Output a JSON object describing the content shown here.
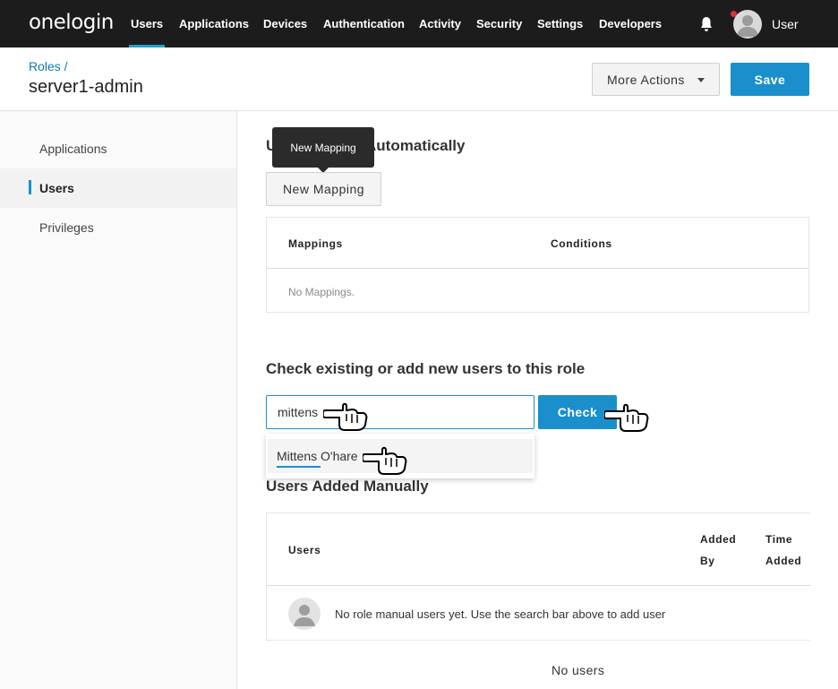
{
  "topnav": {
    "logo": "onelogin",
    "items": [
      {
        "label": "Users",
        "active": true
      },
      {
        "label": "Applications",
        "active": false
      },
      {
        "label": "Devices",
        "active": false
      },
      {
        "label": "Authentication",
        "active": false
      },
      {
        "label": "Activity",
        "active": false
      },
      {
        "label": "Security",
        "active": false
      },
      {
        "label": "Settings",
        "active": false
      },
      {
        "label": "Developers",
        "active": false
      }
    ],
    "user_label": "User",
    "bell_icon": "bell-icon",
    "notification_color": "#e0303a"
  },
  "header": {
    "breadcrumb": "Roles /",
    "title": "server1-admin",
    "more_actions_label": "More Actions",
    "save_label": "Save"
  },
  "sidebar": {
    "items": [
      {
        "label": "Applications",
        "active": false
      },
      {
        "label": "Users",
        "active": true
      },
      {
        "label": "Privileges",
        "active": false
      }
    ]
  },
  "auto_section": {
    "title_prefix": "Us",
    "title_suffix": "Automatically",
    "tooltip": "New Mapping",
    "new_mapping_label": "New Mapping",
    "columns": [
      "Mappings",
      "Conditions"
    ],
    "empty_text": "No Mappings."
  },
  "check_section": {
    "title": "Check existing or add new users to this role",
    "search_value": "mittens",
    "check_label": "Check",
    "suggestion": "Mittens O'hare"
  },
  "manual_section": {
    "title": "Users Added Manually",
    "col_users": "Users",
    "col_added_by_1": "Added",
    "col_added_by_2": "By",
    "col_time_1": "Time",
    "col_time_2": "Added",
    "empty_text": "No role manual users yet. Use the search bar above to add user",
    "no_users": "No users"
  },
  "colors": {
    "accent": "#1a8fcb",
    "nav_bg": "#1c1c1c",
    "nav_active_underline": "#17a6d4"
  }
}
